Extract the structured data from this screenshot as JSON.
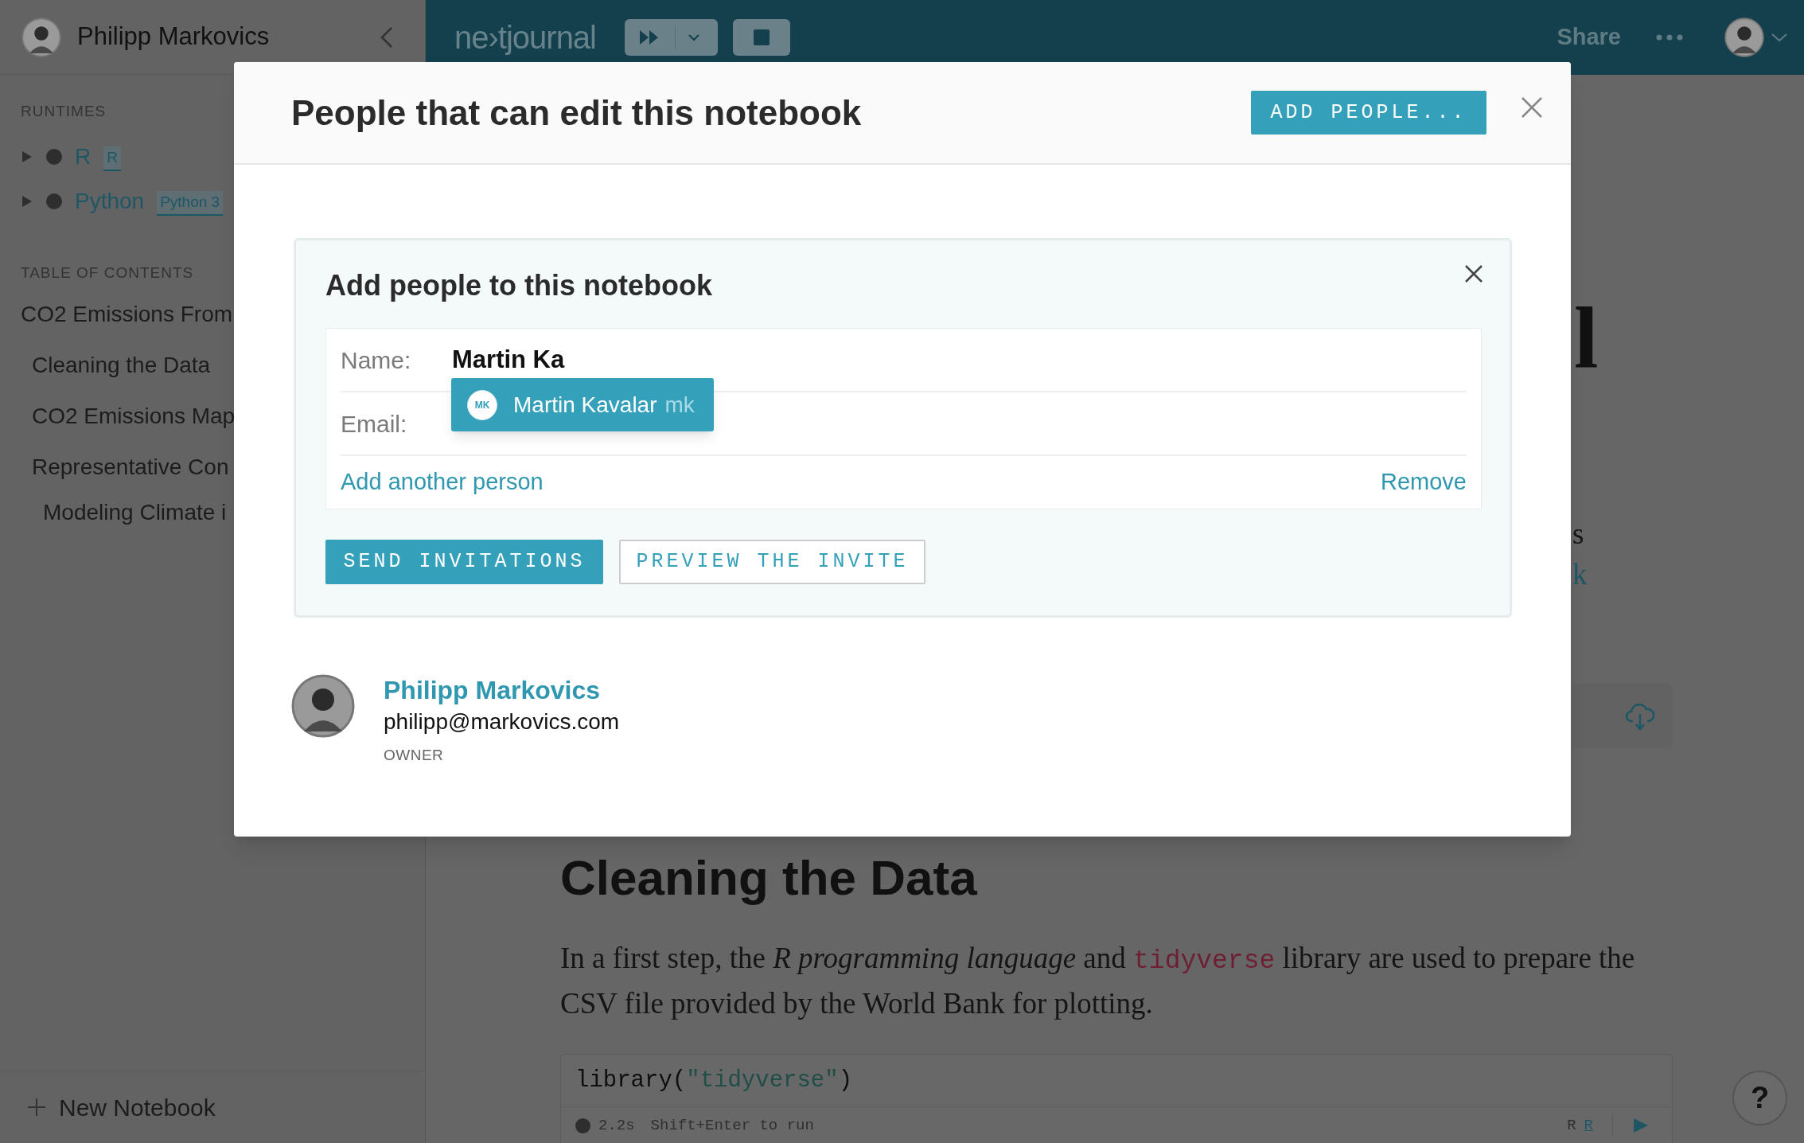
{
  "sidebar": {
    "user_name": "Philipp Markovics",
    "runtimes_heading": "RUNTIMES",
    "runtimes": [
      {
        "name": "R",
        "badge": "R",
        "expanded": false
      },
      {
        "name": "Python",
        "badge": "Python 3",
        "expanded": false
      }
    ],
    "toc_heading": "TABLE OF CONTENTS",
    "toc": [
      {
        "label": "CO2 Emissions From",
        "children": [
          {
            "label": "Cleaning the Data"
          },
          {
            "label": "CO2 Emissions Map"
          },
          {
            "label": "Representative Con",
            "children": [
              {
                "label": "Modeling Climate i"
              }
            ]
          }
        ]
      }
    ],
    "new_notebook": "New Notebook"
  },
  "topbar": {
    "logo": "ne›tjournal",
    "share": "Share"
  },
  "article": {
    "heading_fragment": "l",
    "fragments": [
      {
        "text": "s",
        "kind": "plain"
      },
      {
        "text": "k",
        "kind": "link"
      }
    ],
    "section_title": "Cleaning the Data",
    "paragraph": [
      {
        "text": "In a first step, the ",
        "kind": "plain"
      },
      {
        "text": "R programming language",
        "kind": "italic"
      },
      {
        "text": " and ",
        "kind": "plain"
      },
      {
        "text": "tidyverse",
        "kind": "code"
      },
      {
        "text": " library are used to prepare the CSV file provided by the World Bank for plotting.",
        "kind": "plain"
      }
    ],
    "code_cell": {
      "code": [
        {
          "text": "library(",
          "kind": "plain"
        },
        {
          "text": "\"tidyverse\"",
          "kind": "string"
        },
        {
          "text": ")",
          "kind": "plain"
        }
      ],
      "duration": "2.2s",
      "hint": "Shift+Enter to run",
      "language": "R",
      "runtime": "R"
    }
  },
  "help": "?",
  "modal": {
    "title": "People that can edit this notebook",
    "add_button": "ADD PEOPLE...",
    "add_panel": {
      "title": "Add people to this notebook",
      "fields": [
        {
          "label": "Name:",
          "value": "Martin Ka"
        },
        {
          "label": "Email:"
        }
      ],
      "suggestions": [
        {
          "initials": "MK",
          "name": "Martin Kavalar",
          "handle": "mk",
          "selected": true
        }
      ],
      "add_link": "Add another person",
      "remove_link": "Remove",
      "send_button": "SEND INVITATIONS",
      "preview_button": "PREVIEW THE INVITE"
    },
    "members": [
      {
        "name": "Philipp Markovics",
        "email": "philipp@markovics.com",
        "role": "OWNER"
      }
    ]
  }
}
